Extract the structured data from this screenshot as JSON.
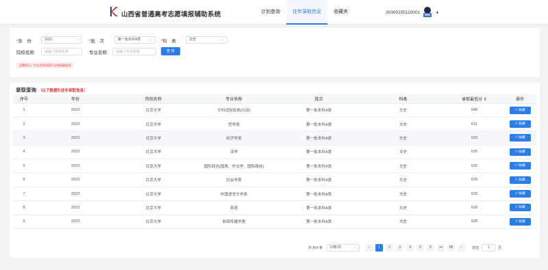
{
  "header": {
    "app_title": "山西省普通高考志愿填报辅助系统",
    "nav": [
      {
        "label": "计划查询",
        "active": false
      },
      {
        "label": "往年录取信息",
        "active": true
      },
      {
        "label": "收藏夹",
        "active": false
      }
    ],
    "user_id": "30300105110001",
    "accent_color": "#2b7de9"
  },
  "filter": {
    "year_label": "年　份",
    "year_value": "2023",
    "batch_label": "批　次",
    "batch_value": "第一批本科A类",
    "subject_label": "科　类",
    "subject_value": "文史",
    "school_label": "院校名称",
    "school_placeholder": "请输入院校名称",
    "major_label": "专业名称",
    "major_placeholder": "请输入专业名称",
    "search_label": "查 询",
    "notice": "温馨提示：专业名称请填写全称精确查询"
  },
  "results": {
    "title": "录取查询",
    "subtitle": "（以下数据为往年录取信息）",
    "columns": [
      "序号",
      "年份",
      "院校名称",
      "专业名称",
      "批次",
      "科类",
      "录取最低分 ⇕",
      "操作"
    ],
    "fav_label": "收藏",
    "rows": [
      {
        "no": "1",
        "year": "2023",
        "school": "北京大学",
        "major": "文科试验班类(元培)",
        "batch": "第一批本科A类",
        "subject": "文史",
        "score": "649"
      },
      {
        "no": "2",
        "year": "2023",
        "school": "北京大学",
        "major": "哲学类",
        "batch": "第一批本科A类",
        "subject": "文史",
        "score": "631"
      },
      {
        "no": "3",
        "year": "2023",
        "school": "北京大学",
        "major": "经济学类",
        "batch": "第一批本科A类",
        "subject": "文史",
        "score": "633"
      },
      {
        "no": "4",
        "year": "2023",
        "school": "北京大学",
        "major": "法学",
        "batch": "第一批本科A类",
        "subject": "文史",
        "score": "635"
      },
      {
        "no": "5",
        "year": "2023",
        "school": "北京大学",
        "major": "国际政治(国政、外交学、国际政经)",
        "batch": "第一批本科A类",
        "subject": "文史",
        "score": "632"
      },
      {
        "no": "6",
        "year": "2023",
        "school": "北京大学",
        "major": "社会学类",
        "batch": "第一批本科A类",
        "subject": "文史",
        "score": "629"
      },
      {
        "no": "7",
        "year": "2023",
        "school": "北京大学",
        "major": "中国语言文学类",
        "batch": "第一批本科A类",
        "subject": "文史",
        "score": "633"
      },
      {
        "no": "8",
        "year": "2023",
        "school": "北京大学",
        "major": "英语",
        "batch": "第一批本科A类",
        "subject": "文史",
        "score": "628"
      },
      {
        "no": "9",
        "year": "2023",
        "school": "北京大学",
        "major": "新闻传播学类",
        "batch": "第一批本科A类",
        "subject": "文史",
        "score": "628"
      }
    ]
  },
  "pagination": {
    "total": "共 854 条",
    "page_size": "10条/页",
    "prev": "‹",
    "pages": [
      "1",
      "2",
      "3",
      "4",
      "5",
      "6",
      "•••",
      "86"
    ],
    "next": "›",
    "goto_label": "前往",
    "goto_value": "1",
    "page_suffix": "页"
  }
}
